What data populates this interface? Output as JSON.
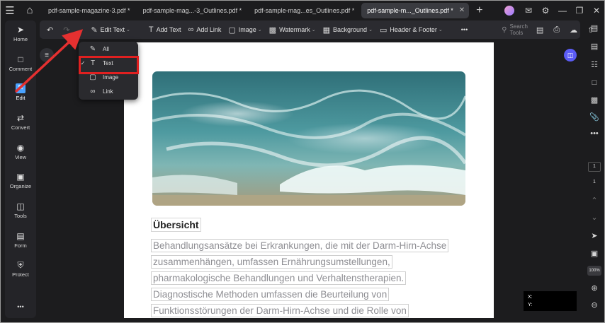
{
  "titlebar": {
    "tabs": [
      {
        "label": "pdf-sample-magazine-3.pdf *",
        "active": false
      },
      {
        "label": "pdf-sample-mag...-3_Outlines.pdf *",
        "active": false
      },
      {
        "label": "pdf-sample-mag...es_Outlines.pdf *",
        "active": false
      },
      {
        "label": "pdf-sample-m..._Outlines.pdf *",
        "active": true
      }
    ],
    "add_tab_icon": "plus-icon",
    "right_icons": [
      "avatar",
      "bell-icon",
      "gear-icon",
      "minimize-icon",
      "restore-icon",
      "close-icon"
    ]
  },
  "sidebar": {
    "items": [
      {
        "label": "Home",
        "icon": "rocket-icon"
      },
      {
        "label": "Comment",
        "icon": "comment-icon"
      },
      {
        "label": "Edit",
        "icon": "edit-icon",
        "active": true
      },
      {
        "label": "Convert",
        "icon": "convert-icon"
      },
      {
        "label": "View",
        "icon": "eye-icon"
      },
      {
        "label": "Organize",
        "icon": "organize-icon"
      },
      {
        "label": "Tools",
        "icon": "toolbox-icon"
      },
      {
        "label": "Form",
        "icon": "form-icon"
      },
      {
        "label": "Protect",
        "icon": "shield-icon"
      }
    ],
    "more": "•••"
  },
  "toolbar": {
    "edit_text": "Edit Text",
    "add_text": "Add Text",
    "add_link": "Add Link",
    "image": "Image",
    "watermark": "Watermark",
    "background": "Background",
    "header_footer": "Header & Footer",
    "more": "•••",
    "search_placeholder": "Search Tools"
  },
  "dropdown": {
    "items": [
      {
        "label": "All",
        "checked": false
      },
      {
        "label": "Text",
        "checked": true
      },
      {
        "label": "Image",
        "checked": false
      },
      {
        "label": "Link",
        "checked": false
      }
    ]
  },
  "document": {
    "heading": "Übersicht",
    "lines": [
      "Behandlungsansätze bei Erkrankungen, die mit der Darm-Hirn-Achse",
      "zusammenhängen, umfassen Ernährungsumstellungen,",
      "pharmakologische Behandlungen und Verhaltenstherapien.",
      "Diagnostische Methoden umfassen die Beurteilung von",
      "Funktionsstörungen der Darm-Hirn-Achse und die Rolle von"
    ]
  },
  "rightbar": {
    "page_current": "1",
    "page_total": "1",
    "zoom": "100%"
  },
  "coords": {
    "x_label": "X:",
    "y_label": "Y:"
  },
  "colors": {
    "accent": "#4aa3ff",
    "highlight": "#e02020",
    "ai": "#5b5cf6"
  }
}
